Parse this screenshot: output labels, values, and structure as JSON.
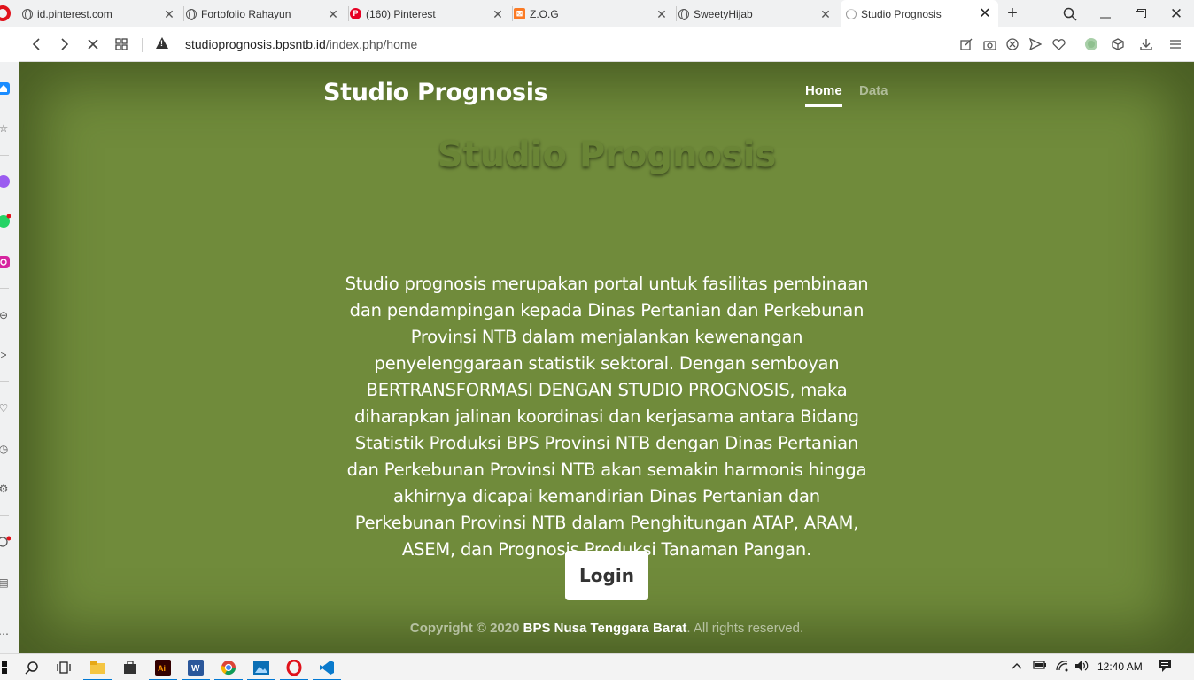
{
  "browser": {
    "tabs": [
      {
        "title": "id.pinterest.com",
        "icon": "globe-icon",
        "active": false
      },
      {
        "title": "Fortofolio Rahayun",
        "icon": "globe-icon",
        "active": false
      },
      {
        "title": "(160) Pinterest",
        "icon": "pinterest-icon",
        "active": false
      },
      {
        "title": "Z.O.G",
        "icon": "xampp-icon",
        "active": false
      },
      {
        "title": "SweetyHijab",
        "icon": "globe-icon",
        "active": false
      },
      {
        "title": "Studio Prognosis",
        "icon": "loading-icon",
        "active": true
      }
    ],
    "address": {
      "domain": "studioprognosis.bpsntb.id",
      "path": "/index.php/home"
    }
  },
  "page": {
    "brand": "Studio Prognosis",
    "nav": {
      "home": "Home",
      "data": "Data"
    },
    "hero_title": "Studio Prognosis",
    "description": "Studio prognosis merupakan portal untuk fasilitas pembinaan dan pendampingan kepada Dinas Pertanian dan Perkebunan Provinsi NTB dalam menjalankan kewenangan penyelenggaraan statistik sektoral. Dengan semboyan BERTRANSFORMASI DENGAN STUDIO PROGNOSIS, maka diharapkan jalinan koordinasi dan kerjasama antara Bidang Statistik Produksi BPS Provinsi NTB dengan Dinas Pertanian dan Perkebunan Provinsi NTB akan semakin harmonis hingga akhirnya dicapai kemandirian Dinas Pertanian dan Perkebunan Provinsi NTB dalam Penghitungan ATAP, ARAM, ASEM, dan Prognosis Produksi Tanaman Pangan.",
    "login_label": "Login",
    "footer": {
      "copyright": "Copyright © 2020",
      "org": "BPS Nusa Tenggara Barat",
      "rights": ". All rights reserved."
    },
    "colors": {
      "background": "#708b3b",
      "text": "#ffffff"
    }
  },
  "taskbar": {
    "time": "12:40 AM"
  }
}
